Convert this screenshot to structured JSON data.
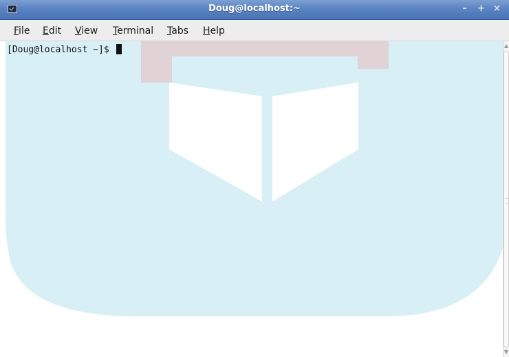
{
  "window": {
    "title": "Doug@localhost:~",
    "minimize_symbol": "–",
    "maximize_symbol": "+",
    "close_symbol": "×"
  },
  "menu": {
    "items": [
      {
        "mnemonic": "F",
        "rest": "ile"
      },
      {
        "mnemonic": "E",
        "rest": "dit"
      },
      {
        "mnemonic": "V",
        "rest": "iew"
      },
      {
        "mnemonic": "T",
        "rest": "erminal"
      },
      {
        "mnemonic": "T",
        "rest": "abs"
      },
      {
        "mnemonic": "H",
        "rest": "elp"
      }
    ]
  },
  "terminal": {
    "prompt": "[Doug@localhost ~]$ ",
    "background": "#ffffff",
    "foreground": "#111111"
  },
  "colors": {
    "titlebar": "#5b84c3",
    "menubar": "#ededed",
    "watermark_light_blue": "#d8eff6",
    "watermark_red": "#d88c8c"
  },
  "icons": {
    "window_icon": "terminal-icon",
    "scroll_up": "scroll-up-arrow-icon",
    "scroll_down": "scroll-down-arrow-icon"
  }
}
